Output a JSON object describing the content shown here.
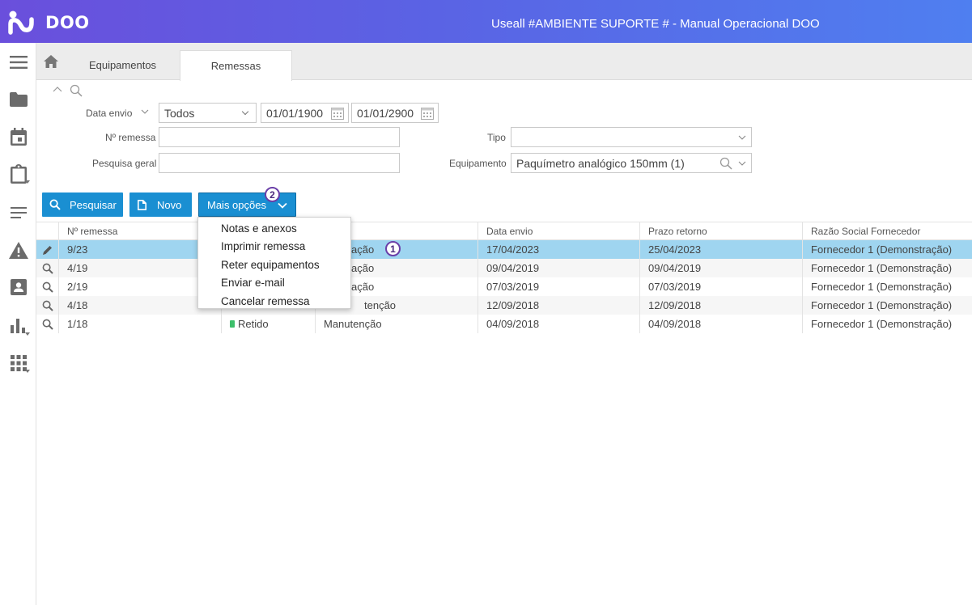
{
  "header": {
    "logo_text": "DOO",
    "app_title": "Useall #AMBIENTE SUPORTE # - Manual Operacional DOO"
  },
  "sidebar": {
    "icons": [
      "menu-icon",
      "folder-icon",
      "calendar-icon",
      "clipboard-icon",
      "list-icon",
      "warning-icon",
      "contact-card-icon",
      "bar-chart-icon",
      "grid-apps-icon"
    ]
  },
  "tabs": [
    {
      "label": "Equipamentos"
    },
    {
      "label": "Remessas"
    }
  ],
  "filters": {
    "data_envio_label": "Data envio",
    "data_envio_mode": "Todos",
    "date_from": "01/01/1900",
    "date_to": "01/01/2900",
    "nro_remessa_label": "Nº remessa",
    "nro_remessa_value": "",
    "pesquisa_geral_label": "Pesquisa geral",
    "pesquisa_geral_value": "",
    "tipo_label": "Tipo",
    "tipo_value": "",
    "equipamento_label": "Equipamento",
    "equipamento_value": "Paquímetro analógico 150mm (1)"
  },
  "toolbar": {
    "search_label": "Pesquisar",
    "new_label": "Novo",
    "more_label": "Mais opções"
  },
  "badges": {
    "menu_badge": "2",
    "row_badge": "1"
  },
  "menu": {
    "items": [
      "Notas e anexos",
      "Imprimir remessa",
      "Reter equipamentos",
      "Enviar e-mail",
      "Cancelar remessa"
    ]
  },
  "table": {
    "columns": [
      "Nº remessa",
      "",
      "",
      "Data envio",
      "Prazo retorno",
      "Razão Social Fornecedor"
    ],
    "rows": [
      {
        "nro": "9/23",
        "status": "",
        "tipo": "ação",
        "data_envio": "17/04/2023",
        "prazo": "25/04/2023",
        "fornecedor": "Fornecedor 1 (Demonstração)",
        "selected": true
      },
      {
        "nro": "4/19",
        "status": "",
        "tipo": "ação",
        "data_envio": "09/04/2019",
        "prazo": "09/04/2019",
        "fornecedor": "Fornecedor 1 (Demonstração)"
      },
      {
        "nro": "2/19",
        "status": "",
        "tipo": "ação",
        "data_envio": "07/03/2019",
        "prazo": "07/03/2019",
        "fornecedor": "Fornecedor 1 (Demonstração)"
      },
      {
        "nro": "4/18",
        "status": "",
        "tipo": "tenção",
        "data_envio": "12/09/2018",
        "prazo": "12/09/2018",
        "fornecedor": "Fornecedor 1 (Demonstração)"
      },
      {
        "nro": "1/18",
        "status": "Retido",
        "tipo": "Manutenção",
        "data_envio": "04/09/2018",
        "prazo": "04/09/2018",
        "fornecedor": "Fornecedor 1 (Demonstração)"
      }
    ]
  },
  "colors": {
    "header_gradient_start": "#6a4fdc",
    "header_gradient_end": "#4f7ff0",
    "button_blue": "#1a8fd2",
    "selected_row": "#9fd5f0",
    "status_green": "#3dbf6b",
    "badge_purple": "#6a3fa8"
  }
}
